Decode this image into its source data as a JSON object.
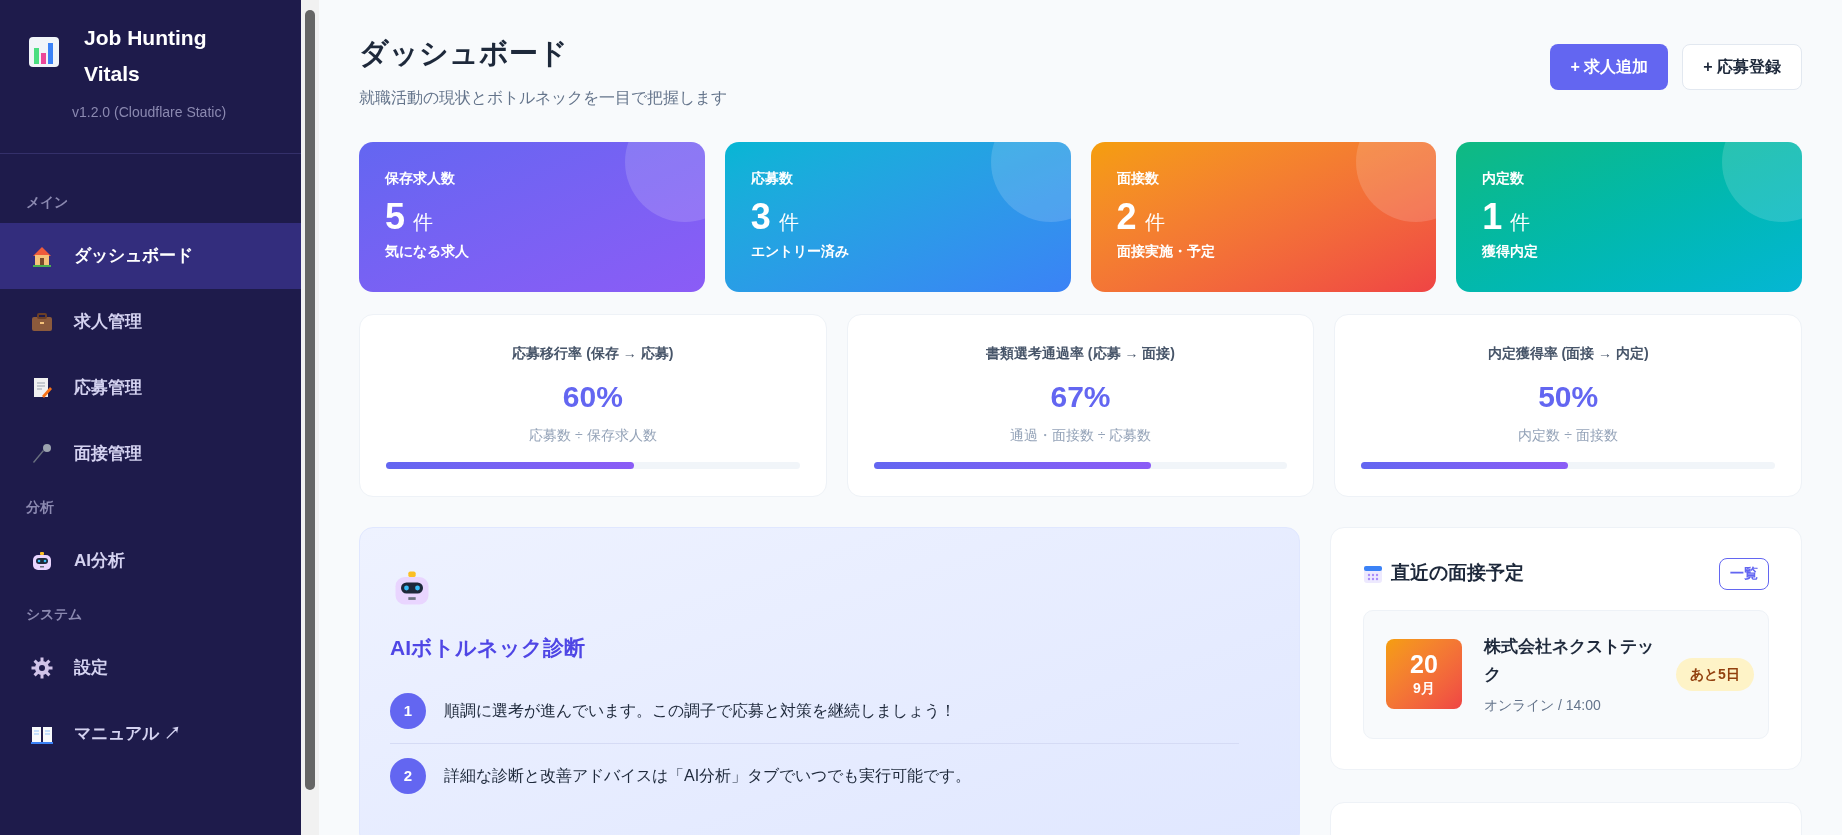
{
  "sidebar": {
    "app_name": "Job Hunting Vitals",
    "version": "v1.2.0 (Cloudflare Static)",
    "sections": [
      {
        "title": "メイン",
        "items": [
          {
            "label": "ダッシュボード",
            "kind": "house",
            "selected": true
          },
          {
            "label": "求人管理",
            "kind": "briefcase",
            "selected": false
          },
          {
            "label": "応募管理",
            "kind": "memo",
            "selected": false
          },
          {
            "label": "面接管理",
            "kind": "mic",
            "selected": false
          }
        ]
      },
      {
        "title": "分析",
        "items": [
          {
            "label": "AI分析",
            "kind": "robot",
            "selected": false
          }
        ]
      },
      {
        "title": "システム",
        "items": [
          {
            "label": "設定",
            "kind": "gear",
            "selected": false
          },
          {
            "label": "マニュアル ↗",
            "kind": "book",
            "selected": false
          }
        ]
      }
    ]
  },
  "header": {
    "title": "ダッシュボード",
    "subtitle": "就職活動の現状とボトルネックを一目で把握します",
    "buttons": [
      {
        "label": "+ 求人追加",
        "kind": "primary"
      },
      {
        "label": "+ 応募登録",
        "kind": "secondary"
      }
    ]
  },
  "stats": [
    {
      "label": "保存求人数",
      "value": "5",
      "unit": "件",
      "note": "気になる求人",
      "kind": "purple"
    },
    {
      "label": "応募数",
      "value": "3",
      "unit": "件",
      "note": "エントリー済み",
      "kind": "blue"
    },
    {
      "label": "面接数",
      "value": "2",
      "unit": "件",
      "note": "面接実施・予定",
      "kind": "orange"
    },
    {
      "label": "内定数",
      "value": "1",
      "unit": "件",
      "note": "獲得内定",
      "kind": "green"
    }
  ],
  "rates": [
    {
      "title": "応募移行率 (保存 → 応募)",
      "value": "60%",
      "formula": "応募数 ÷ 保存求人数",
      "level": 0.6
    },
    {
      "title": "書類選考通過率 (応募 → 面接)",
      "value": "67%",
      "formula": "通過・面接数 ÷ 応募数",
      "level": 0.67
    },
    {
      "title": "内定獲得率 (面接 → 内定)",
      "value": "50%",
      "formula": "内定数 ÷ 面接数",
      "level": 0.5
    }
  ],
  "ai_panel": {
    "title": "AIボトルネック診断",
    "items": [
      {
        "number": "1",
        "text": "順調に選考が進んでいます。この調子で応募と対策を継続しましょう！"
      },
      {
        "number": "2",
        "text": "詳細な診断と改善アドバイスは「AI分析」タブでいつでも実行可能です。"
      }
    ]
  },
  "upcoming": {
    "title": "直近の面接予定",
    "link": "一覧",
    "items": [
      {
        "day": "20",
        "month": "9月",
        "company": "株式会社ネクストテック",
        "detail": "オンライン / 14:00",
        "badge": "あと5日"
      }
    ]
  }
}
